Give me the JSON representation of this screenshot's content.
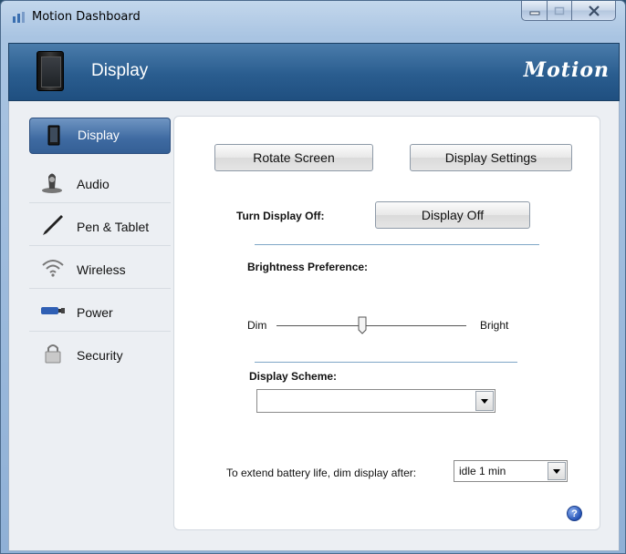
{
  "window": {
    "title": "Motion Dashboard"
  },
  "header": {
    "title": "Display",
    "logo": "Motion"
  },
  "sidebar": {
    "items": [
      {
        "label": "Display",
        "icon": "tablet-icon",
        "active": true
      },
      {
        "label": "Audio",
        "icon": "speaker-icon",
        "active": false
      },
      {
        "label": "Pen & Tablet",
        "icon": "pen-icon",
        "active": false
      },
      {
        "label": "Wireless",
        "icon": "wireless-icon",
        "active": false
      },
      {
        "label": "Power",
        "icon": "battery-icon",
        "active": false
      },
      {
        "label": "Security",
        "icon": "lock-icon",
        "active": false
      }
    ]
  },
  "panel": {
    "rotate_button": "Rotate Screen",
    "display_settings_button": "Display Settings",
    "turn_off_label": "Turn Display Off:",
    "display_off_button": "Display Off",
    "brightness_label": "Brightness Preference:",
    "brightness": {
      "min_label": "Dim",
      "max_label": "Bright",
      "value_fraction": 0.45
    },
    "scheme_label": "Display Scheme:",
    "scheme_value": "",
    "battery_label": "To extend battery life, dim display after:",
    "battery_value": "idle 1 min"
  },
  "help": {
    "label": "?"
  },
  "colors": {
    "accent": "#3e6aa1",
    "banner": "#2a5d8f",
    "separator": "#7fa6c6"
  }
}
